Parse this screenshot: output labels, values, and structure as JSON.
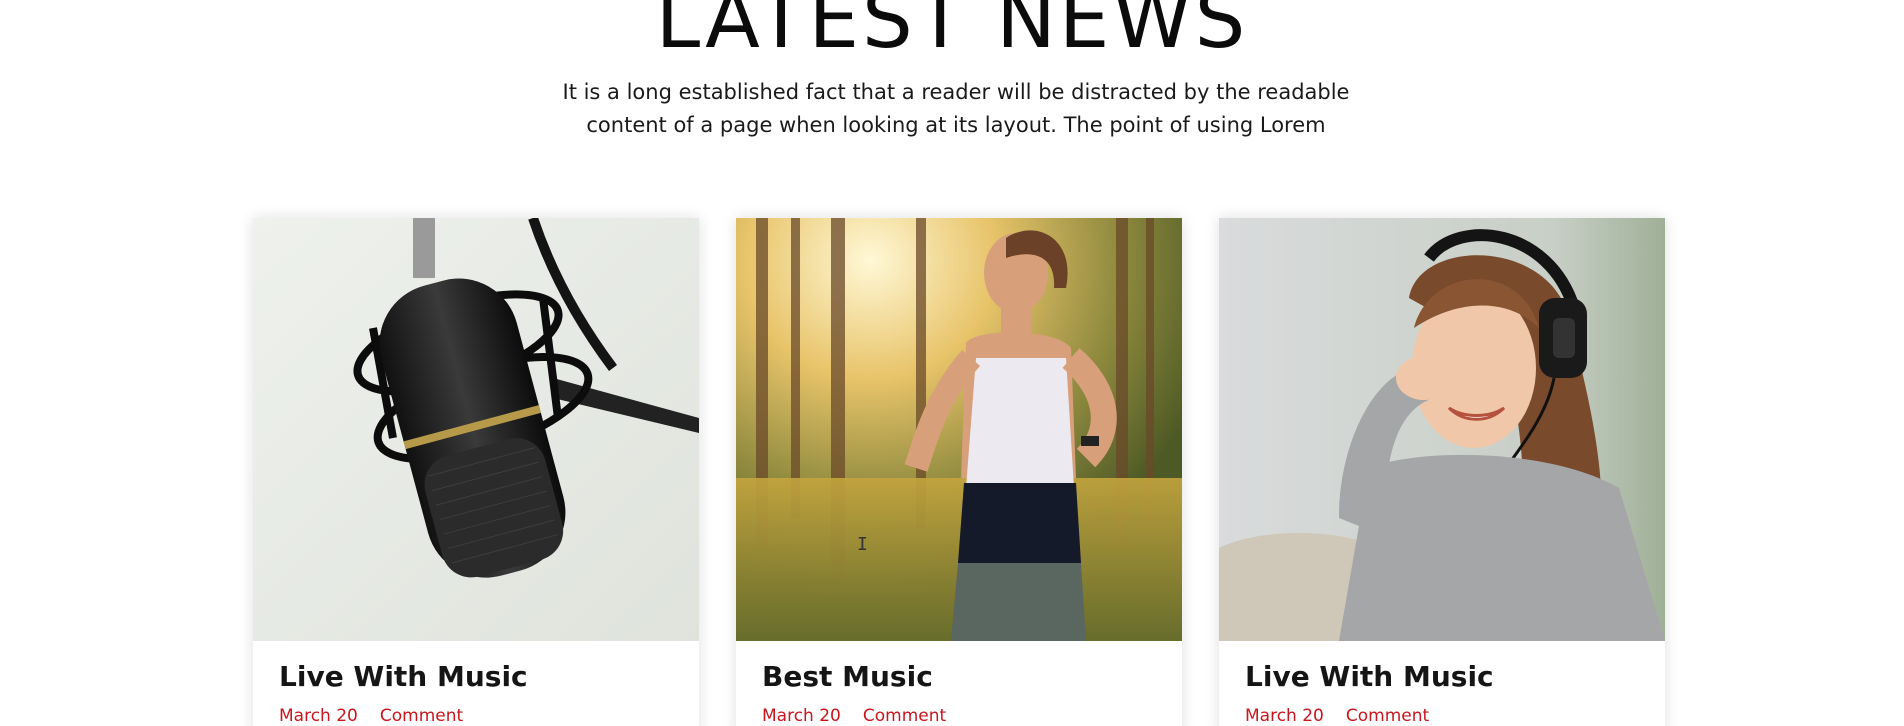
{
  "section": {
    "title": "LATEST NEWS",
    "subtitle": "It is a long established fact that a reader will be distracted by the readable content of a page when looking at its layout. The point of using Lorem"
  },
  "cards": [
    {
      "image": "microphone-photo",
      "title": "Live With Music",
      "date": "March 20",
      "comment": "Comment"
    },
    {
      "image": "woman-running-photo",
      "title": "Best Music",
      "date": "March 20",
      "comment": "Comment"
    },
    {
      "image": "woman-headphones-photo",
      "title": "Live With Music",
      "date": "March 20",
      "comment": "Comment"
    }
  ],
  "colors": {
    "accent": "#c8161d",
    "heading": "#0b0b0b",
    "background": "#ffffff"
  }
}
